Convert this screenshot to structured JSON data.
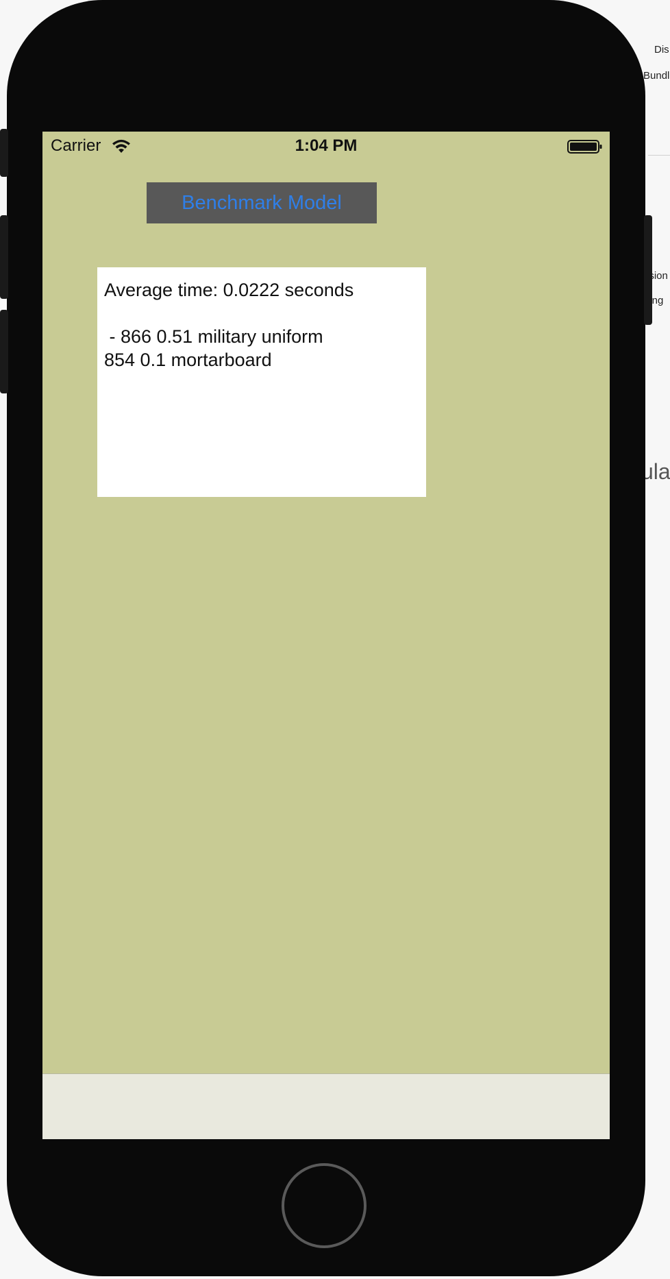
{
  "background": {
    "fragments": [
      "Dis",
      "Bundl",
      "ision",
      "hing",
      "ula"
    ]
  },
  "status_bar": {
    "carrier": "Carrier",
    "time": "1:04 PM",
    "wifi_icon": "wifi-icon",
    "battery_icon": "battery-icon"
  },
  "main": {
    "benchmark_button_label": "Benchmark Model",
    "result_lines": [
      "Average time: 0.0222 seconds",
      "",
      " - 866 0.51 military uniform",
      "854 0.1 mortarboard"
    ]
  },
  "colors": {
    "screen_background": "#c8cb94",
    "button_background": "#585858",
    "button_text": "#2f7fe8",
    "phone_frame": "#0a0a0a",
    "bottom_bar": "#e9e9de"
  }
}
